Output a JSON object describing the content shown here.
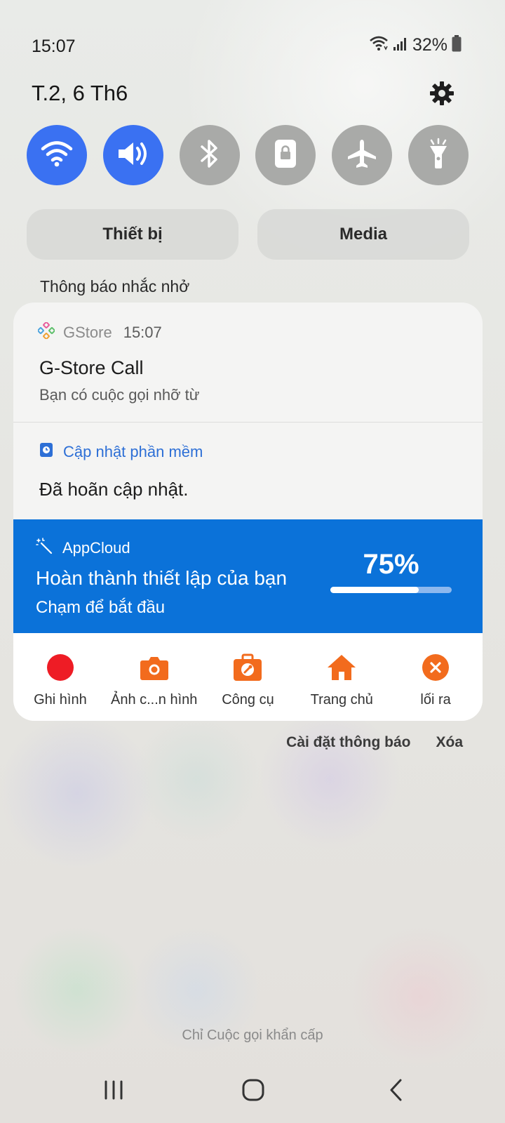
{
  "status_bar": {
    "time": "15:07",
    "battery": "32%",
    "icons": [
      "wifi-icon",
      "signal-icon",
      "battery-icon"
    ]
  },
  "header": {
    "date": "T.2, 6 Th6",
    "settings_icon": "gear-icon"
  },
  "quick_toggles": [
    {
      "name": "wifi",
      "icon": "wifi-icon",
      "active": true
    },
    {
      "name": "sound",
      "icon": "speaker-icon",
      "active": true
    },
    {
      "name": "bluetooth",
      "icon": "bluetooth-icon",
      "active": false
    },
    {
      "name": "screen-lock",
      "icon": "lock-rotate-icon",
      "active": false
    },
    {
      "name": "airplane",
      "icon": "airplane-icon",
      "active": false
    },
    {
      "name": "flashlight",
      "icon": "flashlight-icon",
      "active": false
    }
  ],
  "output_buttons": {
    "device": "Thiết bị",
    "media": "Media"
  },
  "section": {
    "label": "Thông báo nhắc nhở"
  },
  "notifications": [
    {
      "app": "GStore",
      "time": "15:07",
      "title": "G-Store Call",
      "text": "Bạn có cuộc gọi nhỡ từ"
    },
    {
      "app": "Cập nhật phần mềm",
      "text": "Đã hoãn cập nhật."
    },
    {
      "app": "AppCloud",
      "title": "Hoàn thành thiết lập của bạn",
      "text": "Chạm để bắt đầu",
      "percent_label": "75%",
      "progress": 0.73
    }
  ],
  "actions": [
    {
      "label": "Ghi hình",
      "icon": "record-icon"
    },
    {
      "label": "Ảnh c...n hình",
      "icon": "camera-icon"
    },
    {
      "label": "Công cụ",
      "icon": "toolbox-icon"
    },
    {
      "label": "Trang chủ",
      "icon": "home-icon"
    },
    {
      "label": "lối ra",
      "icon": "exit-icon"
    }
  ],
  "footer": {
    "settings_link": "Cài đặt thông báo",
    "clear_link": "Xóa",
    "emergency": "Chỉ Cuộc gọi khẩn cấp"
  },
  "colors": {
    "toggle_on": "#3a71f2",
    "toggle_off": "#a9aaa8",
    "appcloud_bg": "#0b72d9",
    "action_orange": "#f26b1d",
    "record_red": "#ee1c25",
    "link_blue": "#2d6fd6"
  }
}
